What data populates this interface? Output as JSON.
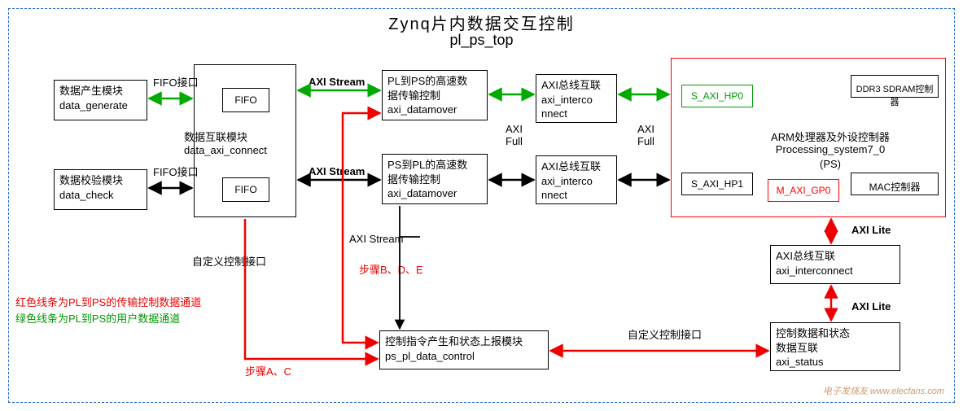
{
  "title": "Zynq片内数据交互控制",
  "subtitle": "pl_ps_top",
  "boxes": {
    "data_generate": {
      "l1": "数据产生模块",
      "l2": "data_generate"
    },
    "data_check": {
      "l1": "数据校验模块",
      "l2": "data_check"
    },
    "data_axi_connect": {
      "l1": "数据互联模块",
      "l2": "data_axi_connect"
    },
    "fifo1": "FIFO",
    "fifo2": "FIFO",
    "pl2ps_dm": {
      "l1": "PL到PS的高速数",
      "l2": "据传输控制",
      "l3": "axi_datamover"
    },
    "ps2pl_dm": {
      "l1": "PS到PL的高速数",
      "l2": "据传输控制",
      "l3": "axi_datamover"
    },
    "axi_ic1": {
      "l1": "AXI总线互联",
      "l2": "axi_interco",
      "l3": "nnect"
    },
    "axi_ic2": {
      "l1": "AXI总线互联",
      "l2": "axi_interco",
      "l3": "nnect"
    },
    "axi_ic3": {
      "l1": "AXI总线互联",
      "l2": "axi_interconnect"
    },
    "ps_arm": {
      "l1": "ARM处理器及外设控制器",
      "l2": "Processing_system7_0",
      "l3": "(PS)"
    },
    "s_axi_hp0": "S_AXI_HP0",
    "s_axi_hp1": "S_AXI_HP1",
    "m_axi_gp0": "M_AXI_GP0",
    "ddr3": "DDR3 SDRAM控制器",
    "mac": "MAC控制器",
    "ps_pl_ctrl": {
      "l1": "控制指令产生和状态上报模块",
      "l2": "ps_pl_data_control"
    },
    "axi_status": {
      "l1": "控制数据和状态",
      "l2": "数据互联",
      "l3": "axi_status"
    }
  },
  "labels": {
    "fifo_if1": "FIFO接口",
    "fifo_if2": "FIFO接口",
    "axi_stream1": "AXI Stream",
    "axi_stream2": "AXI Stream",
    "axi_stream3": "AXI Stream",
    "axi_full1": "AXI\nFull",
    "axi_full2": "AXI\nFull",
    "axi_lite1": "AXI Lite",
    "axi_lite2": "AXI Lite",
    "custom_ctrl1": "自定义控制接口",
    "custom_ctrl2": "自定义控制接口",
    "step_bde": "步骤B、D、E",
    "step_ac": "步骤A、C",
    "legend_red": "红色线条为PL到PS的传输控制数据通道",
    "legend_green": "绿色线条为PL到PS的用户数据通道"
  },
  "watermark": "电子发烧友\nwww.elecfans.com"
}
